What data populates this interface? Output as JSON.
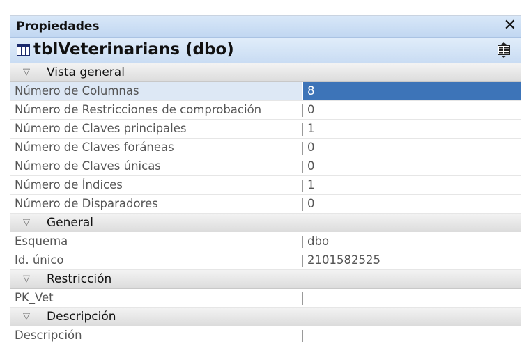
{
  "panel": {
    "title": "Propiedades",
    "close_glyph": "✕",
    "object_title": "tblVeterinarians (dbo)",
    "object_icon": "table-icon",
    "property_pages_icon": "property-pages-icon"
  },
  "sections": [
    {
      "title": "Vista general",
      "rows": [
        {
          "name": "Número de Columnas",
          "value": "8",
          "selected": true
        },
        {
          "name": "Número de Restricciones de comprobación",
          "value": "0"
        },
        {
          "name": "Número de Claves principales",
          "value": "1"
        },
        {
          "name": "Número de Claves foráneas",
          "value": "0"
        },
        {
          "name": "Número de Claves únicas",
          "value": "0"
        },
        {
          "name": "Número de Índices",
          "value": "1"
        },
        {
          "name": "Número de Disparadores",
          "value": "0"
        }
      ]
    },
    {
      "title": "General",
      "rows": [
        {
          "name": "Esquema",
          "value": "dbo"
        },
        {
          "name": "Id. único",
          "value": "2101582525"
        }
      ]
    },
    {
      "title": "Restricción",
      "rows": [
        {
          "name": "PK_Vet",
          "value": ""
        }
      ]
    },
    {
      "title": "Descripción",
      "rows": [
        {
          "name": "Descripción",
          "value": ""
        }
      ]
    }
  ],
  "colors": {
    "selection": "#3d74b8",
    "header": "#c9dcf3"
  }
}
